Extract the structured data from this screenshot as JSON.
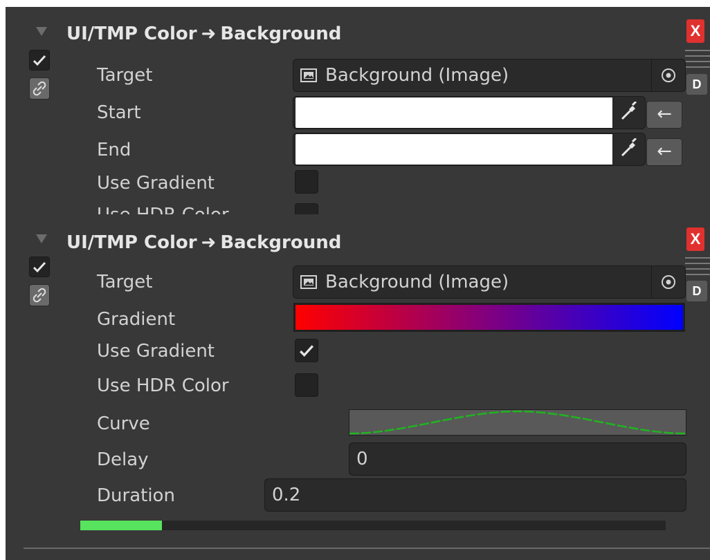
{
  "colors": {
    "panel_bg": "#383838",
    "field_bg": "#2a2a2a",
    "close_red": "#e0312f",
    "progress_green": "#58e35e",
    "curve_green": "#1fb51f",
    "gradient_start": "#ff0000",
    "gradient_end": "#0000ff"
  },
  "block1": {
    "title_left": "UI/TMP Color",
    "arrow": "➜",
    "title_right": "Background",
    "enabled": true,
    "close_label": "X",
    "d_label": "D",
    "target_label": "Target",
    "target_value": "Background (Image)",
    "start_label": "Start",
    "end_label": "End",
    "back_arrow": "←",
    "use_gradient_label": "Use Gradient",
    "use_gradient": false,
    "use_hdr_label": "Use HDR Color"
  },
  "block2": {
    "title_left": "UI/TMP Color",
    "arrow": "➜",
    "title_right": "Background",
    "enabled": true,
    "close_label": "X",
    "d_label": "D",
    "target_label": "Target",
    "target_value": "Background (Image)",
    "gradient_label": "Gradient",
    "use_gradient_label": "Use Gradient",
    "use_gradient": true,
    "use_hdr_label": "Use HDR Color",
    "use_hdr": false,
    "curve_label": "Curve",
    "delay_label": "Delay",
    "delay_value": "0",
    "duration_label": "Duration",
    "duration_value": "0.2",
    "progress": 0.14
  },
  "icons": {
    "fold": "triangle-down-icon",
    "check": "checkmark-icon",
    "link": "chain-link-icon",
    "image": "image-icon",
    "object_picker": "target-circle-icon",
    "eyedropper": "eyedropper-icon",
    "drag": "drag-handle-icon"
  }
}
